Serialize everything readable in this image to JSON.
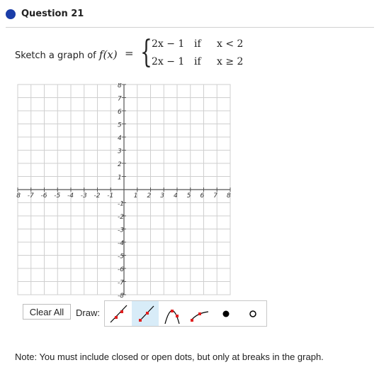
{
  "question": {
    "title": "Question 21"
  },
  "prompt": {
    "text": "Sketch a graph of",
    "function": "f(x)",
    "equals": "="
  },
  "piecewise": [
    {
      "expr": "2x − 1",
      "if": "if",
      "cond": "x < 2"
    },
    {
      "expr": "2x − 1",
      "if": "if",
      "cond": "x ≥ 2"
    }
  ],
  "graph": {
    "x_ticks": [
      "-8",
      "-7",
      "-6",
      "-5",
      "-4",
      "-3",
      "-2",
      "-1",
      "1",
      "2",
      "3",
      "4",
      "5",
      "6",
      "7",
      "8"
    ],
    "y_ticks": [
      "8",
      "7",
      "6",
      "5",
      "4",
      "3",
      "2",
      "1",
      "-1",
      "-2",
      "-3",
      "-4",
      "-5",
      "-6",
      "-7",
      "-8"
    ],
    "xlim": [
      -8,
      8
    ],
    "ylim": [
      -8,
      8
    ]
  },
  "controls": {
    "clear_label": "Clear All",
    "draw_label": "Draw:",
    "tools": [
      {
        "name": "line-tool-icon",
        "selected": false
      },
      {
        "name": "ray-tool-icon",
        "selected": true
      },
      {
        "name": "parabola-tool-icon",
        "selected": false
      },
      {
        "name": "curve-tool-icon",
        "selected": false
      },
      {
        "name": "closed-dot-tool-icon",
        "selected": false
      },
      {
        "name": "open-dot-tool-icon",
        "selected": false
      }
    ]
  },
  "note": "Note: You must include closed or open dots, but only at breaks in the graph.",
  "colors": {
    "accent": "#1a3da8",
    "selected_tool": "#d8ecf8",
    "tool_point": "#e02020"
  }
}
